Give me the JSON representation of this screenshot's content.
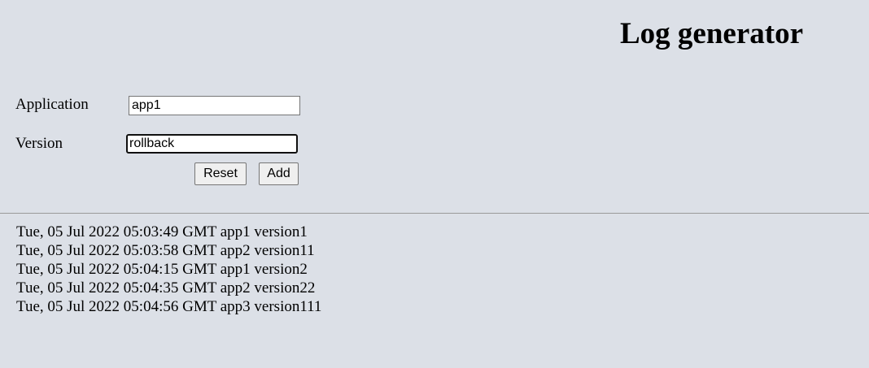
{
  "header": {
    "title": "Log generator"
  },
  "form": {
    "application": {
      "label": "Application",
      "value": "app1"
    },
    "version": {
      "label": "Version",
      "value": "rollback"
    },
    "reset_label": "Reset",
    "add_label": "Add"
  },
  "logs": [
    {
      "text": "Tue, 05 Jul 2022 05:03:49 GMT app1 version1"
    },
    {
      "text": "Tue, 05 Jul 2022 05:03:58 GMT app2 version11"
    },
    {
      "text": "Tue, 05 Jul 2022 05:04:15 GMT app1 version2"
    },
    {
      "text": "Tue, 05 Jul 2022 05:04:35 GMT app2 version22"
    },
    {
      "text": "Tue, 05 Jul 2022 05:04:56 GMT app3 version111"
    }
  ]
}
